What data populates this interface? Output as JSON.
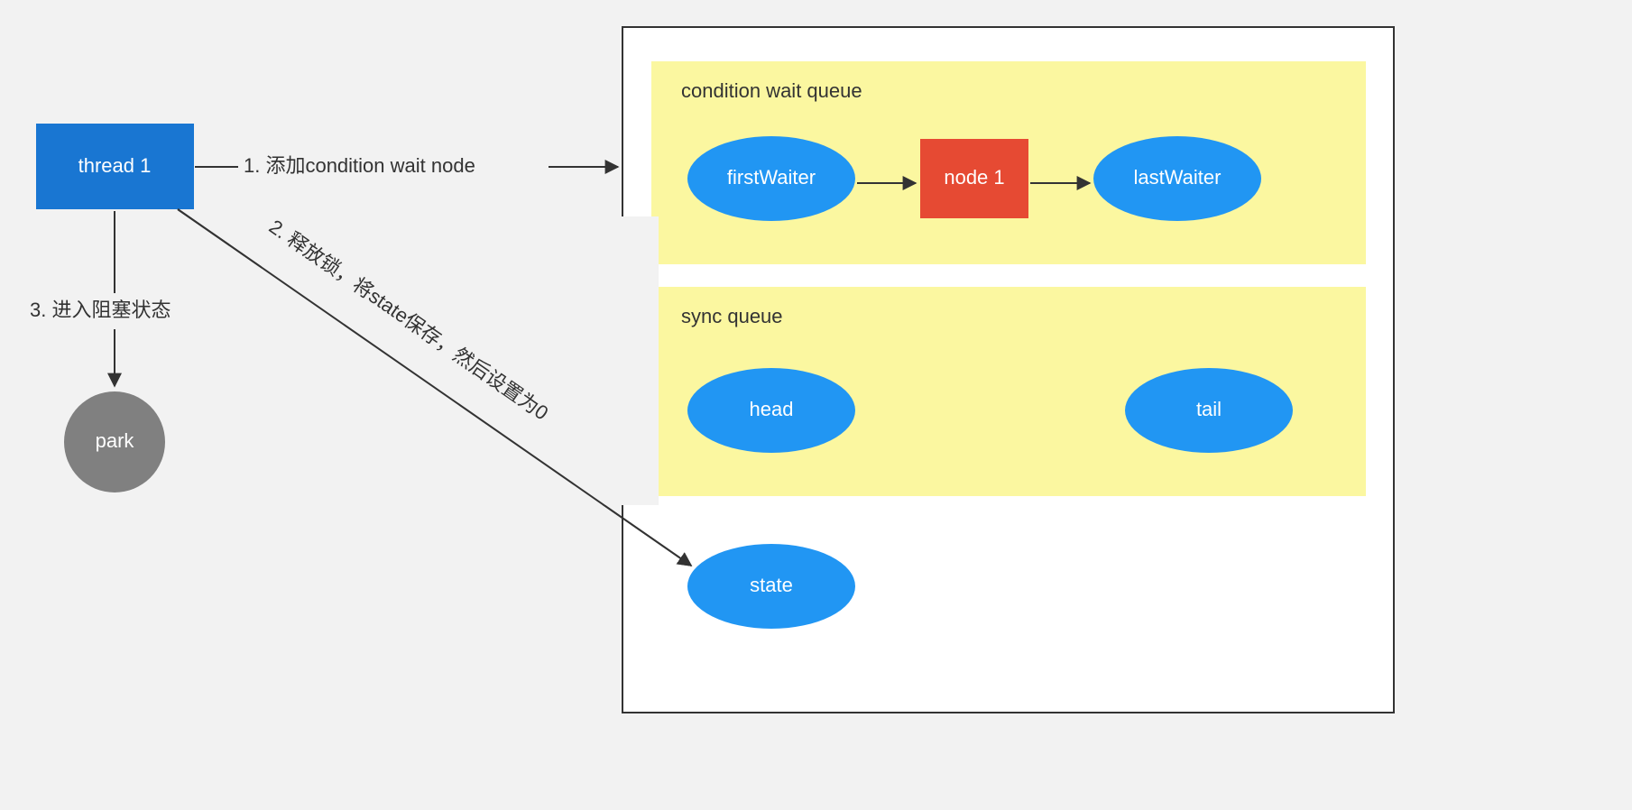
{
  "thread": {
    "label": "thread 1"
  },
  "park": {
    "label": "park"
  },
  "conditionWaitQueue": {
    "title": "condition wait queue",
    "firstWaiter": "firstWaiter",
    "node1": "node 1",
    "lastWaiter": "lastWaiter"
  },
  "syncQueue": {
    "title": "sync queue",
    "head": "head",
    "tail": "tail"
  },
  "state": {
    "label": "state"
  },
  "step1": "1. 添加condition wait node",
  "step2": "2. 释放锁，将state保存，然后设置为0",
  "step3": "3. 进入阻塞状态"
}
